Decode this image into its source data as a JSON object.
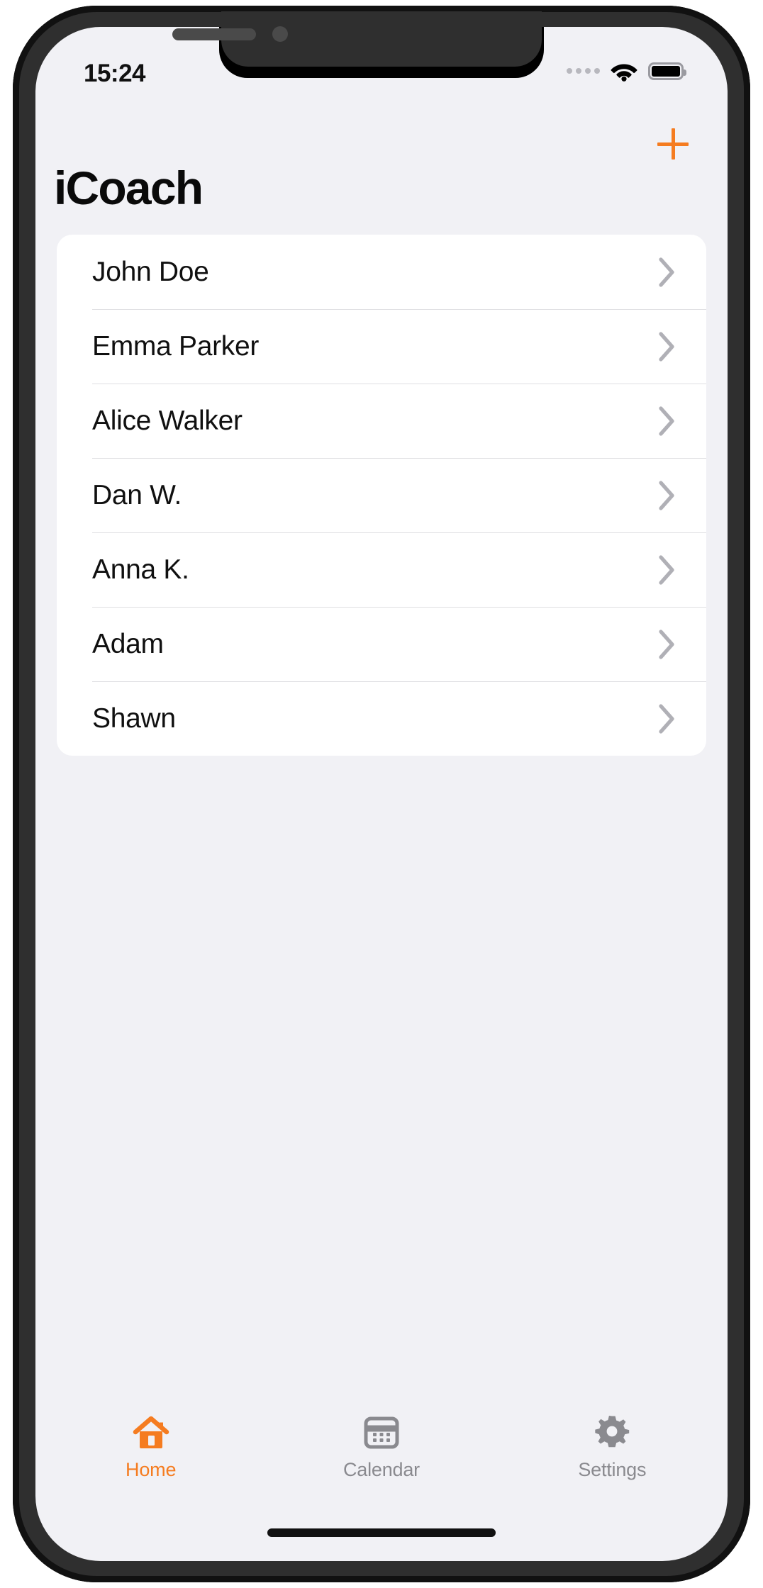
{
  "status_bar": {
    "time": "15:24",
    "signal_dots": 4,
    "wifi_icon": "wifi-icon",
    "battery_icon": "battery-full-icon"
  },
  "header": {
    "title": "iCoach",
    "add_button_icon": "plus-icon"
  },
  "list": {
    "chevron_icon": "chevron-right-icon",
    "items": [
      {
        "name": "John Doe"
      },
      {
        "name": "Emma Parker"
      },
      {
        "name": "Alice Walker"
      },
      {
        "name": "Dan W."
      },
      {
        "name": "Anna K."
      },
      {
        "name": "Adam"
      },
      {
        "name": "Shawn"
      }
    ]
  },
  "tab_bar": {
    "tabs": [
      {
        "label": "Home",
        "icon": "home-icon",
        "active": true
      },
      {
        "label": "Calendar",
        "icon": "calendar-icon",
        "active": false
      },
      {
        "label": "Settings",
        "icon": "gear-icon",
        "active": false
      }
    ]
  },
  "colors": {
    "accent": "#f57c20",
    "inactive": "#8a8a8f",
    "screen_bg": "#f1f1f5",
    "card_bg": "#ffffff",
    "separator": "#dfdfe2",
    "text": "#101010"
  }
}
